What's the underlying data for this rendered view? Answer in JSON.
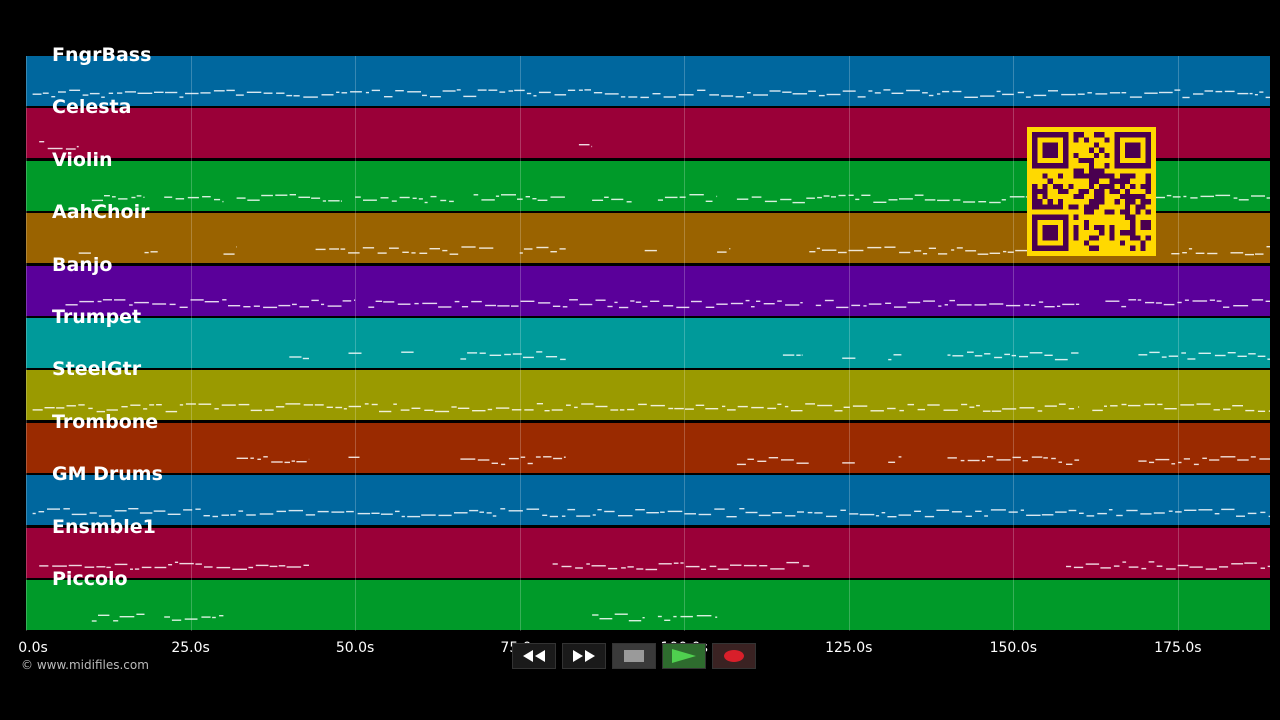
{
  "tracks": [
    {
      "name": "FngrBass",
      "color": "#00679e"
    },
    {
      "name": "Celesta",
      "color": "#9a0038"
    },
    {
      "name": "Violin",
      "color": "#009a29"
    },
    {
      "name": "AahChoir",
      "color": "#9a6300"
    },
    {
      "name": "Banjo",
      "color": "#5a009a"
    },
    {
      "name": "Trumpet",
      "color": "#009a9a"
    },
    {
      "name": "SteelGtr",
      "color": "#9a9a00"
    },
    {
      "name": "Trombone",
      "color": "#9a2a00"
    },
    {
      "name": "GM Drums",
      "color": "#00679e"
    },
    {
      "name": "Ensmble1",
      "color": "#9a0038"
    },
    {
      "name": "Piccolo",
      "color": "#009a29"
    }
  ],
  "axis": {
    "unit": "s",
    "max_seconds": 189,
    "ticks": [
      "0.0s",
      "25.0s",
      "50.0s",
      "75.0s",
      "100.0s",
      "125.0s",
      "150.0s",
      "175.0s"
    ],
    "tick_values": [
      0,
      25,
      50,
      75,
      100,
      125,
      150,
      175
    ]
  },
  "credit": "© www.midifiles.com",
  "controls": [
    {
      "name": "rewind-button",
      "icon": "rewind-icon"
    },
    {
      "name": "fast-forward-button",
      "icon": "fast-forward-icon"
    },
    {
      "name": "stop-button",
      "icon": "stop-icon"
    },
    {
      "name": "play-button",
      "icon": "play-icon"
    },
    {
      "name": "record-button",
      "icon": "record-icon"
    }
  ],
  "colors": {
    "background": "#000000",
    "qr_background": "#ffd900",
    "qr_foreground": "#4a0050",
    "play": "#2e8b2e",
    "record": "#d81f2a"
  },
  "activity": [
    [
      [
        1,
        189
      ]
    ],
    [
      [
        2,
        8
      ],
      [
        84,
        86
      ]
    ],
    [
      [
        10,
        18
      ],
      [
        21,
        30
      ],
      [
        32,
        48
      ],
      [
        50,
        65
      ],
      [
        68,
        82
      ],
      [
        86,
        92
      ],
      [
        96,
        105
      ],
      [
        108,
        160
      ],
      [
        163,
        189
      ]
    ],
    [
      [
        8,
        10
      ],
      [
        18,
        20
      ],
      [
        30,
        32
      ],
      [
        44,
        71
      ],
      [
        75,
        82
      ],
      [
        94,
        96
      ],
      [
        105,
        107
      ],
      [
        119,
        160
      ],
      [
        174,
        181
      ],
      [
        183,
        189
      ]
    ],
    [
      [
        6,
        50
      ],
      [
        52,
        118
      ],
      [
        120,
        160
      ],
      [
        164,
        189
      ]
    ],
    [
      [
        40,
        43
      ],
      [
        49,
        51
      ],
      [
        57,
        59
      ],
      [
        66,
        82
      ],
      [
        115,
        118
      ],
      [
        124,
        126
      ],
      [
        131,
        133
      ],
      [
        140,
        160
      ],
      [
        169,
        189
      ]
    ],
    [
      [
        1,
        160
      ],
      [
        162,
        189
      ]
    ],
    [
      [
        32,
        43
      ],
      [
        49,
        51
      ],
      [
        66,
        82
      ],
      [
        108,
        119
      ],
      [
        124,
        126
      ],
      [
        131,
        133
      ],
      [
        140,
        160
      ],
      [
        169,
        189
      ]
    ],
    [
      [
        1,
        189
      ]
    ],
    [
      [
        2,
        43
      ],
      [
        80,
        119
      ],
      [
        158,
        189
      ]
    ],
    [
      [
        10,
        18
      ],
      [
        21,
        30
      ],
      [
        86,
        94
      ],
      [
        96,
        105
      ]
    ]
  ]
}
